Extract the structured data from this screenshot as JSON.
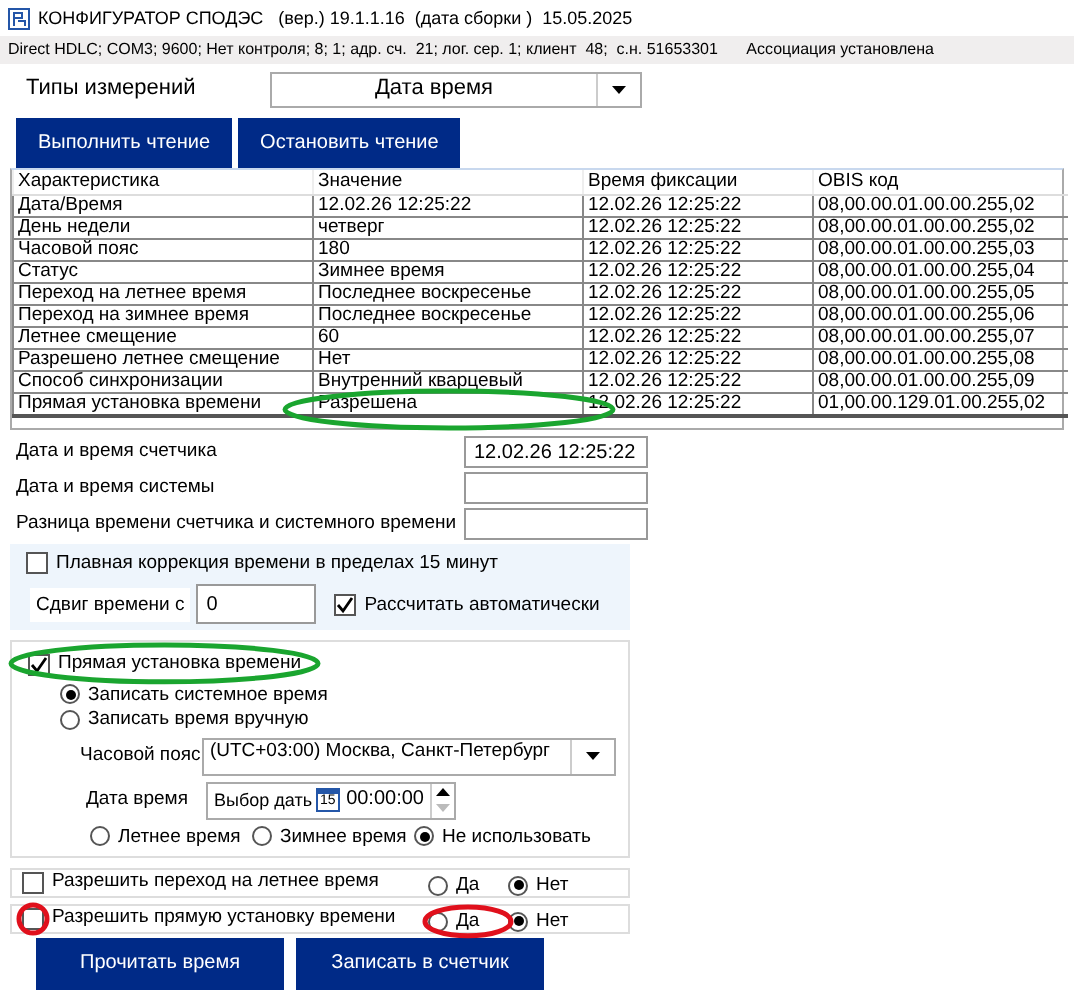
{
  "window": {
    "title": "КОНФИГУРАТОР СПОДЭС   (вер.) 19.1.1.16  (дата сборки )  15.05.2025"
  },
  "status_bar": {
    "connection": "Direct HDLC; COM3; 9600; Нет контроля; 8; 1; адр. сч.  21; лог. сер. 1; клиент  48;  с.н. 51653301",
    "association": "Ассоциация установлена"
  },
  "measurement_type": {
    "label": "Типы измерений",
    "value": "Дата время"
  },
  "read_buttons": [
    "Выполнить чтение",
    "Остановить чтение"
  ],
  "table": {
    "columns": [
      "Характеристика",
      "Значение",
      "Время фиксации",
      "OBIS код"
    ],
    "rows": [
      [
        "Дата/Время",
        "12.02.26 12:25:22",
        "12.02.26 12:25:22",
        "08,00.00.01.00.00.255,02"
      ],
      [
        "День недели",
        "четверг",
        "12.02.26 12:25:22",
        "08,00.00.01.00.00.255,02"
      ],
      [
        "Часовой пояс",
        "180",
        "12.02.26 12:25:22",
        "08,00.00.01.00.00.255,03"
      ],
      [
        "Статус",
        "Зимнее время",
        "12.02.26 12:25:22",
        "08,00.00.01.00.00.255,04"
      ],
      [
        "Переход на летнее время",
        "Последнее воскресенье",
        "12.02.26 12:25:22",
        "08,00.00.01.00.00.255,05"
      ],
      [
        "Переход на зимнее время",
        "Последнее воскресенье",
        "12.02.26 12:25:22",
        "08,00.00.01.00.00.255,06"
      ],
      [
        "Летнее смещение",
        "60",
        "12.02.26 12:25:22",
        "08,00.00.01.00.00.255,07"
      ],
      [
        "Разрешено летнее смещение",
        "Нет",
        "12.02.26 12:25:22",
        "08,00.00.01.00.00.255,08"
      ],
      [
        "Способ синхронизации",
        "Внутренний кварцевый",
        "12.02.26 12:25:22",
        "08,00.00.01.00.00.255,09"
      ],
      [
        "Прямая установка времени",
        "Разрешена",
        "12.02.26 12:25:22",
        "01,00.00.129.01.00.255,02"
      ]
    ]
  },
  "fields": [
    {
      "label": "Дата и время счетчика",
      "value": "12.02.26 12:25:22"
    },
    {
      "label": "Дата и время системы"
    },
    {
      "label": "Разница времени счетчика и системного времени"
    }
  ],
  "smooth_correction": {
    "label": "Плавная коррекция времени в пределах 15 минут",
    "checked": false,
    "shift_label": "Сдвиг времени с",
    "shift_value": "0",
    "auto_label": "Рассчитать автоматически",
    "auto_checked": true
  },
  "direct_set": {
    "label": "Прямая установка времени",
    "checked": true,
    "modes": [
      {
        "label": "Записать системное время",
        "selected": true
      },
      {
        "label": "Записать время вручную",
        "selected": false
      }
    ],
    "timezone_label": "Часовой пояс",
    "timezone_value": "(UTC+03:00) Москва, Санкт-Петербург",
    "datetime_label": "Дата время",
    "date_value": "Выбор дать",
    "calendar_day": "15",
    "time_value": "00:00:00",
    "seasons": [
      {
        "label": "Летнее время",
        "selected": false
      },
      {
        "label": "Зимнее время",
        "selected": false
      },
      {
        "label": "Не использовать",
        "selected": true
      }
    ]
  },
  "permissions": [
    {
      "label": "Разрешить переход на летнее время",
      "checked": false,
      "options": [
        {
          "label": "Да",
          "selected": false
        },
        {
          "label": "Нет",
          "selected": true
        }
      ]
    },
    {
      "label": "Разрешить прямую установку времени",
      "checked": false,
      "options": [
        {
          "label": "Да",
          "selected": false
        },
        {
          "label": "Нет",
          "selected": true
        }
      ]
    }
  ],
  "buttons": [
    "Прочитать время",
    "Записать в счетчик"
  ],
  "annotations": [
    {
      "color": "#1aa52f"
    },
    {
      "color": "#1aa52f"
    },
    {
      "color": "#e0101c"
    },
    {
      "color": "#e0101c"
    }
  ]
}
